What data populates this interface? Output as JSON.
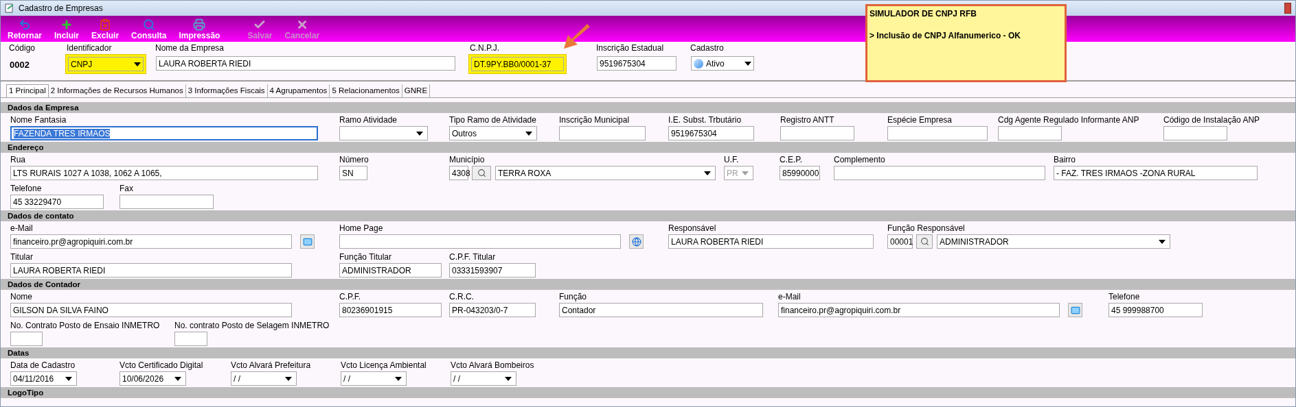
{
  "window": {
    "title": "Cadastro de Empresas"
  },
  "toolbar": [
    {
      "label": "Retornar",
      "kind": "return",
      "disabled": false
    },
    {
      "label": "Incluir",
      "kind": "add",
      "disabled": false
    },
    {
      "label": "Excluir",
      "kind": "delete",
      "disabled": false
    },
    {
      "label": "Consulta",
      "kind": "search",
      "disabled": false
    },
    {
      "label": "Impressão",
      "kind": "print",
      "disabled": false
    },
    {
      "label": "Salvar",
      "kind": "save",
      "disabled": true
    },
    {
      "label": "Cancelar",
      "kind": "cancel",
      "disabled": true
    }
  ],
  "header": [
    {
      "label": "Código",
      "kind": "static",
      "value": "0002",
      "highlighted": false
    },
    {
      "label": "Identificador",
      "kind": "combo",
      "value": "CNPJ",
      "highlighted": true
    },
    {
      "label": "Nome da Empresa",
      "kind": "text",
      "value": "LAURA ROBERTA RIEDI",
      "highlighted": false
    },
    {
      "label": "C.N.P.J.",
      "kind": "text",
      "value": "DT.9PY.BB0/0001-37",
      "highlighted": true
    },
    {
      "label": "Inscrição Estadual",
      "kind": "text",
      "value": "9519675304",
      "highlighted": false
    },
    {
      "label": "Cadastro",
      "kind": "status",
      "value": "Ativo",
      "highlighted": false
    }
  ],
  "note": {
    "title": "SIMULADOR DE CNPJ RFB",
    "text": "> Inclusão de CNPJ Alfanumerico - OK"
  },
  "tabs": [
    {
      "label": "1 Principal",
      "selected": true
    },
    {
      "label": "2 Informações de Recursos Humanos",
      "selected": false
    },
    {
      "label": "3 Informações Fiscais",
      "selected": false
    },
    {
      "label": "4 Agrupamentos",
      "selected": false
    },
    {
      "label": "5 Relacionamentos",
      "selected": false
    },
    {
      "label": "GNRE",
      "selected": false
    }
  ],
  "sections": [
    {
      "title": "Dados da Empresa",
      "lines": [
        [
          {
            "label": "Nome Fantasia",
            "kind": "text",
            "value": "FAZENDA TRES IRMAOS",
            "focused": true
          },
          {
            "label": "Ramo Atividade",
            "kind": "combo"
          },
          {
            "label": "Tipo Ramo de Atividade",
            "kind": "combo",
            "value": "Outros"
          },
          {
            "label": "Inscrição Municipal",
            "kind": "text"
          },
          {
            "label": "I.E. Subst. Trbutário",
            "kind": "text",
            "value": "9519675304"
          },
          {
            "label": "Registro ANTT",
            "kind": "text"
          },
          {
            "label": "Espécie Empresa",
            "kind": "text"
          },
          {
            "label": "Cdg Agente Regulado Informante ANP",
            "kind": "text"
          },
          {
            "label": "Código de Instalação ANP",
            "kind": "text"
          }
        ]
      ]
    },
    {
      "title": "Endereço",
      "lines": [
        [
          {
            "label": "Rua",
            "kind": "text",
            "value": "LTS RURAIS 1027 A 1038, 1062 A 1065,"
          },
          {
            "label": "Número",
            "kind": "text",
            "value": "SN"
          },
          {
            "label": "Município",
            "kind": "lookup",
            "code": "4308",
            "value": "TERRA ROXA"
          },
          {
            "label": "U.F.",
            "kind": "combo",
            "value": "PR",
            "disabled": true
          },
          {
            "label": "C.E.P.",
            "kind": "text",
            "value": "85990000"
          },
          {
            "label": "Complemento",
            "kind": "text"
          },
          {
            "label": "Bairro",
            "kind": "text",
            "value": "- FAZ. TRES IRMAOS -ZONA RURAL"
          }
        ],
        [
          {
            "label": "Telefone",
            "kind": "text",
            "value": "45 33229470"
          },
          {
            "label": "Fax",
            "kind": "text"
          }
        ]
      ]
    },
    {
      "title": "Dados de contato",
      "lines": [
        [
          {
            "label": "e-Mail",
            "kind": "email",
            "value": "financeiro.pr@agropiquiri.com.br"
          },
          {
            "label": "Home Page",
            "kind": "url"
          },
          {
            "label": "Responsável",
            "kind": "text",
            "value": "LAURA ROBERTA RIEDI"
          },
          {
            "label": "Função Responsável",
            "kind": "lookup",
            "code": "00001",
            "value": "ADMINISTRADOR"
          }
        ],
        [
          {
            "label": "Titular",
            "kind": "text",
            "value": "LAURA ROBERTA RIEDI"
          },
          {
            "label": "Função Titular",
            "kind": "text",
            "value": "ADMINISTRADOR"
          },
          {
            "label": "C.P.F. Titular",
            "kind": "text",
            "value": "03331593907"
          }
        ]
      ]
    },
    {
      "title": "Dados de Contador",
      "lines": [
        [
          {
            "label": "Nome",
            "kind": "text",
            "value": "GILSON DA SILVA FAINO"
          },
          {
            "label": "C.P.F.",
            "kind": "text",
            "value": "80236901915"
          },
          {
            "label": "C.R.C.",
            "kind": "text",
            "value": "PR-043203/0-7"
          },
          {
            "label": "Função",
            "kind": "text",
            "value": "Contador"
          },
          {
            "label": "e-Mail",
            "kind": "email",
            "value": "financeiro.pr@agropiquiri.com.br"
          },
          {
            "label": "Telefone",
            "kind": "text",
            "value": "45 999988700"
          }
        ],
        [
          {
            "label": "No. Contrato Posto de Ensaio INMETRO",
            "kind": "text"
          },
          {
            "label": "No. contrato Posto de Selagem INMETRO",
            "kind": "text"
          }
        ]
      ]
    },
    {
      "title": "Datas",
      "lines": [
        [
          {
            "label": "Data de Cadastro",
            "kind": "date",
            "value": "04/11/2016"
          },
          {
            "label": "Vcto Certificado Digital",
            "kind": "date",
            "value": "10/06/2026"
          },
          {
            "label": "Vcto Alvará Prefeitura",
            "kind": "date",
            "value": " / /"
          },
          {
            "label": "Vcto Licença Ambiental",
            "kind": "date",
            "value": " / /"
          },
          {
            "label": "Vcto Alvará Bombeiros",
            "kind": "date",
            "value": " / /"
          }
        ]
      ]
    },
    {
      "title": "LogoTipo"
    }
  ]
}
